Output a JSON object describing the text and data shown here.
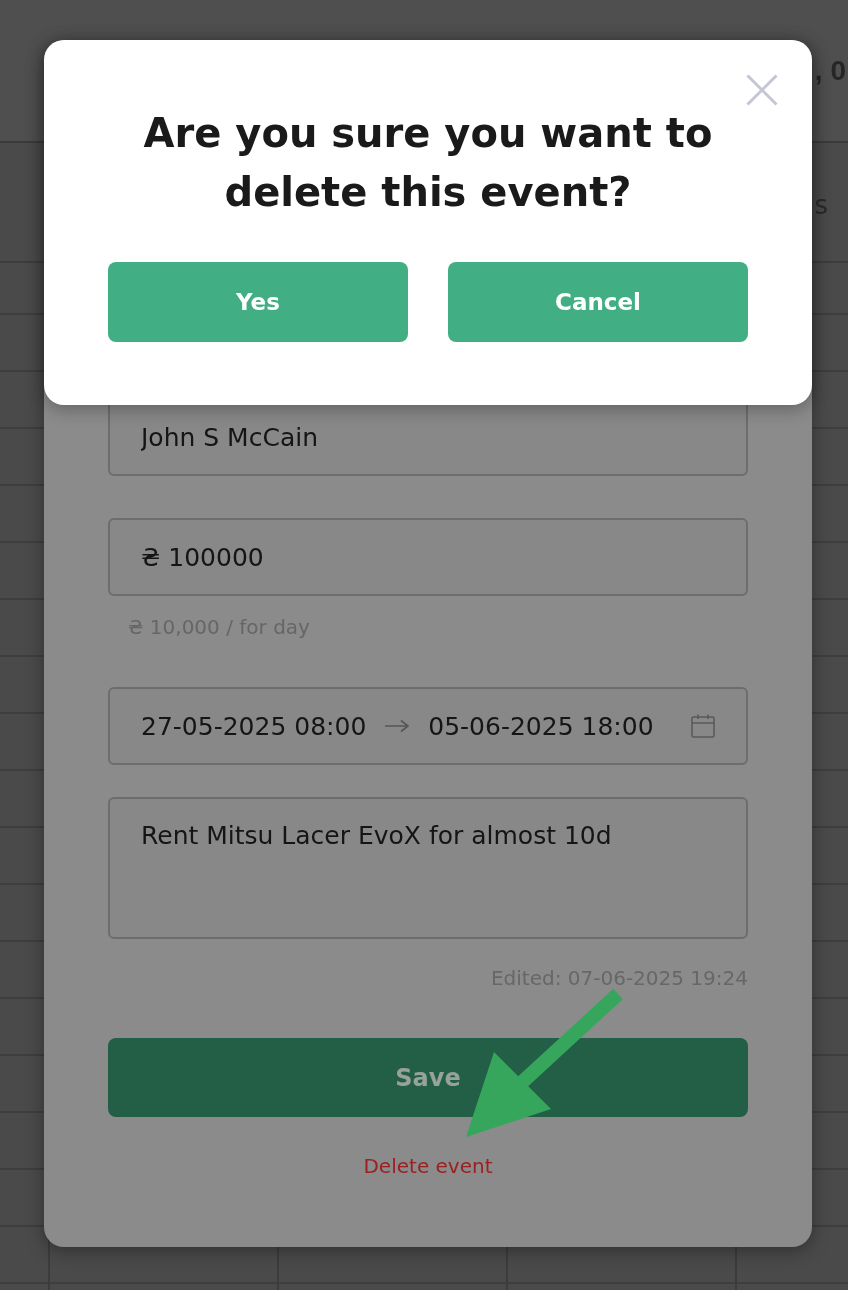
{
  "calendar": {
    "header_fragment": ", 0",
    "day_heading_fragment": "s"
  },
  "event_form": {
    "fields": [
      {
        "kind": "text",
        "value": "John S McCain"
      },
      {
        "kind": "money",
        "value": "₴ 100000",
        "helper_text": "₴ 10,000 / for day"
      },
      {
        "kind": "date_range",
        "start": "27-05-2025 08:00",
        "end": "05-06-2025 18:00"
      },
      {
        "kind": "textarea",
        "value": "Rent Mitsu Lacer EvoX for almost 10d"
      }
    ],
    "edited_note": "Edited: 07-06-2025 19:24",
    "save_button": "Save",
    "delete_link": "Delete event"
  },
  "confirm_dialog": {
    "title": "Are you sure you want to delete this event?",
    "buttons": [
      "Yes",
      "Cancel"
    ]
  }
}
